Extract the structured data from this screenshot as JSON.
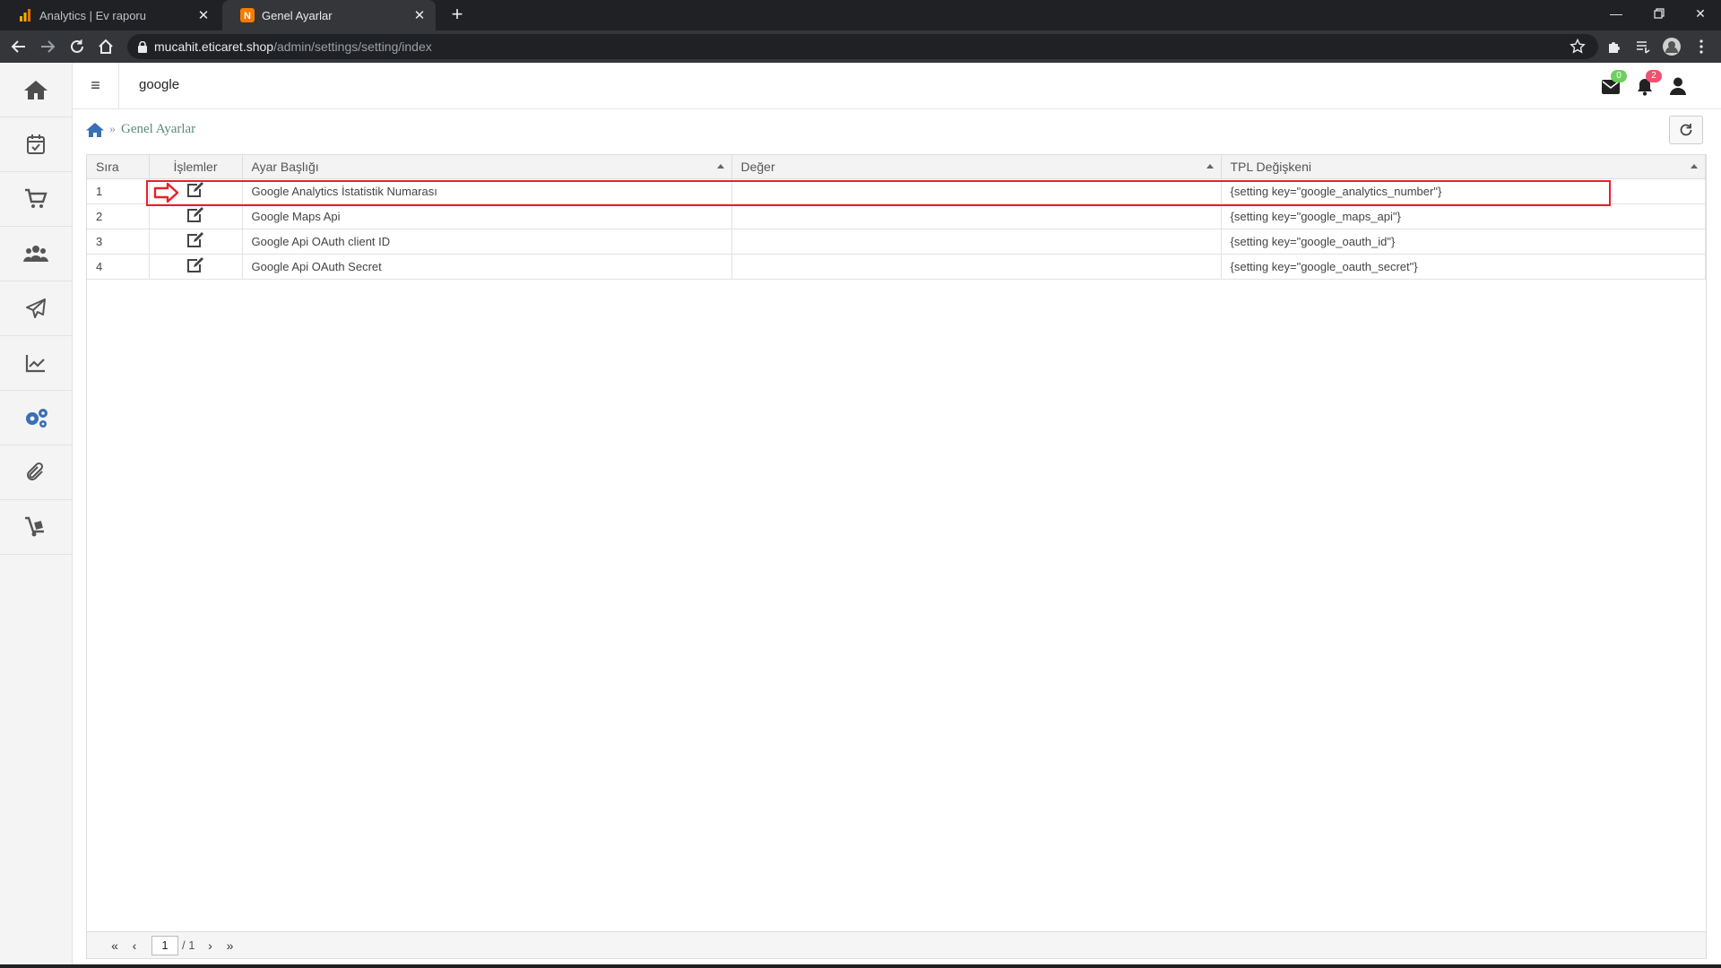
{
  "browser": {
    "tabs": [
      {
        "title": "Analytics | Ev raporu",
        "active": false
      },
      {
        "title": "Genel Ayarlar",
        "active": true
      }
    ],
    "url_host": "mucahit.eticaret.shop",
    "url_path": "/admin/settings/setting/index"
  },
  "topbar": {
    "search_value": "google",
    "mail_count": "0",
    "notification_count": "2"
  },
  "breadcrumb": {
    "current": "Genel Ayarlar"
  },
  "table": {
    "headers": {
      "sira": "Sıra",
      "islemler": "İşlemler",
      "ayar_basligi": "Ayar Başlığı",
      "deger": "Değer",
      "tpl": "TPL Değişkeni"
    },
    "rows": [
      {
        "sira": "1",
        "title": "Google Analytics İstatistik Numarası",
        "value": "",
        "tpl": "{setting key=\"google_analytics_number\"}"
      },
      {
        "sira": "2",
        "title": "Google Maps Api",
        "value": "",
        "tpl": "{setting key=\"google_maps_api\"}"
      },
      {
        "sira": "3",
        "title": "Google Api OAuth client ID",
        "value": "",
        "tpl": "{setting key=\"google_oauth_id\"}"
      },
      {
        "sira": "4",
        "title": "Google Api OAuth Secret",
        "value": "",
        "tpl": "{setting key=\"google_oauth_secret\"}"
      }
    ]
  },
  "pager": {
    "page": "1",
    "total": "/ 1"
  },
  "colors": {
    "accent_blue": "#3a6fb5",
    "highlight_red": "#e8202a",
    "mail_badge": "#6ccf5f",
    "notif_badge": "#f0506e"
  }
}
